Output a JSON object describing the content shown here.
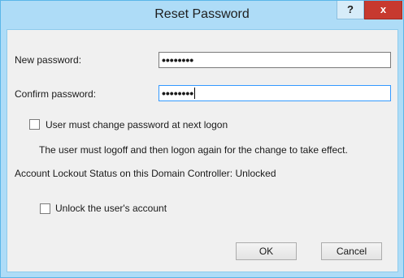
{
  "window": {
    "title": "Reset Password",
    "help_label": "?",
    "close_label": "x"
  },
  "form": {
    "new_password_label": "New password:",
    "new_password_value": "••••••••",
    "confirm_password_label": "Confirm password:",
    "confirm_password_value": "••••••••",
    "must_change_label": "User must change password at next logon",
    "must_change_checked": false,
    "info_text": "The user must logoff and then logon again for the change to take effect.",
    "lockout_status_text": "Account Lockout Status on this Domain Controller: Unlocked",
    "unlock_label": "Unlock the user's account",
    "unlock_checked": false
  },
  "buttons": {
    "ok_label": "OK",
    "cancel_label": "Cancel"
  },
  "colors": {
    "frame": "#aedcf7",
    "close_button": "#c7392f",
    "focus_border": "#3399ff"
  }
}
